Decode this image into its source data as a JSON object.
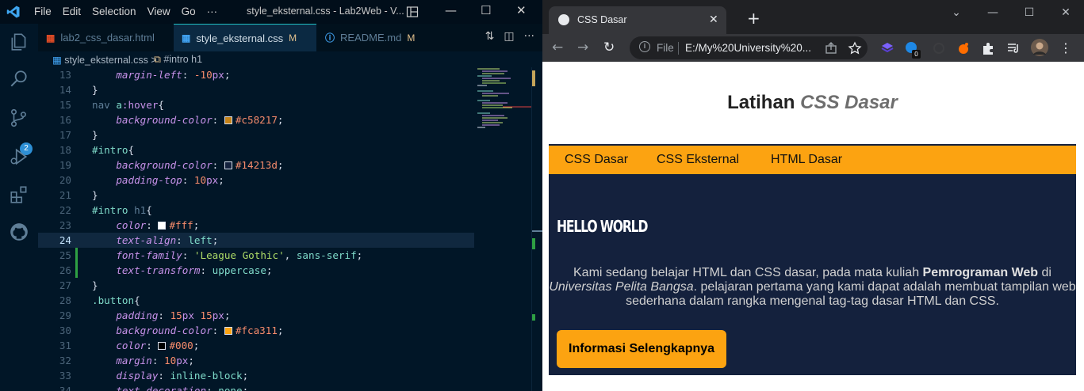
{
  "vscode": {
    "menu": [
      "File",
      "Edit",
      "Selection",
      "View",
      "Go",
      "···"
    ],
    "window_title": "style_eksternal.css - Lab2Web - V...",
    "tabs": [
      {
        "label": "lab2_css_dasar.html",
        "icon": "html-icon",
        "modified": ""
      },
      {
        "label": "style_eksternal.css",
        "icon": "css-icon",
        "modified": "M"
      },
      {
        "label": "README.md",
        "icon": "info-icon",
        "modified": "M"
      }
    ],
    "breadcrumb": {
      "file": "style_eksternal.css",
      "separator": ">",
      "symbol": "#intro h1"
    },
    "scm_badge": "2",
    "code_lines": [
      {
        "n": "13",
        "text": "    margin-left: -10px;"
      },
      {
        "n": "14",
        "text": "}"
      },
      {
        "n": "15",
        "text": "nav a:hover{"
      },
      {
        "n": "16",
        "text": "    background-color: #c58217;"
      },
      {
        "n": "17",
        "text": "}"
      },
      {
        "n": "18",
        "text": "#intro{"
      },
      {
        "n": "19",
        "text": "    background-color: #14213d;"
      },
      {
        "n": "20",
        "text": "    padding-top: 10px;"
      },
      {
        "n": "21",
        "text": "}"
      },
      {
        "n": "22",
        "text": "#intro h1{"
      },
      {
        "n": "23",
        "text": "    color: #fff;"
      },
      {
        "n": "24",
        "text": "    text-align: left;"
      },
      {
        "n": "25",
        "text": "    font-family: 'League Gothic', sans-serif;"
      },
      {
        "n": "26",
        "text": "    text-transform: uppercase;"
      },
      {
        "n": "27",
        "text": "}"
      },
      {
        "n": "28",
        "text": ".button{"
      },
      {
        "n": "29",
        "text": "    padding: 15px 15px;"
      },
      {
        "n": "30",
        "text": "    background-color: #fca311;"
      },
      {
        "n": "31",
        "text": "    color: #000;"
      },
      {
        "n": "32",
        "text": "    margin: 10px;"
      },
      {
        "n": "33",
        "text": "    display: inline-block;"
      },
      {
        "n": "34",
        "text": "    text-decoration: none;"
      }
    ],
    "current_line": "24"
  },
  "chrome": {
    "tab_title": "CSS Dasar",
    "omnibox": {
      "scheme": "File",
      "url": "E:/My%20University%20..."
    },
    "extension_badge": "0"
  },
  "site": {
    "title_plain": "Latihan",
    "title_em": "CSS Dasar",
    "nav": [
      "CSS Dasar",
      "CSS Eksternal",
      "HTML Dasar"
    ],
    "hero_heading": "HELLO WORLD",
    "intro_p1": "Kami sedang belajar HTML dan CSS dasar, pada mata kuliah",
    "intro_bold": "Pemrograman Web",
    "intro_p2": "di",
    "intro_italic": "Universitas Pelita Bangsa",
    "intro_p3": ". pelajaran pertama yang kami dapat adalah membuat tampilan web sederhana dalam rangka mengenal tag-tag dasar HTML dan CSS.",
    "button_label": "Informasi Selengkapnya"
  },
  "colors": {
    "accent_orange": "#fca311",
    "navy": "#14213d",
    "hover_orange": "#c58217"
  }
}
